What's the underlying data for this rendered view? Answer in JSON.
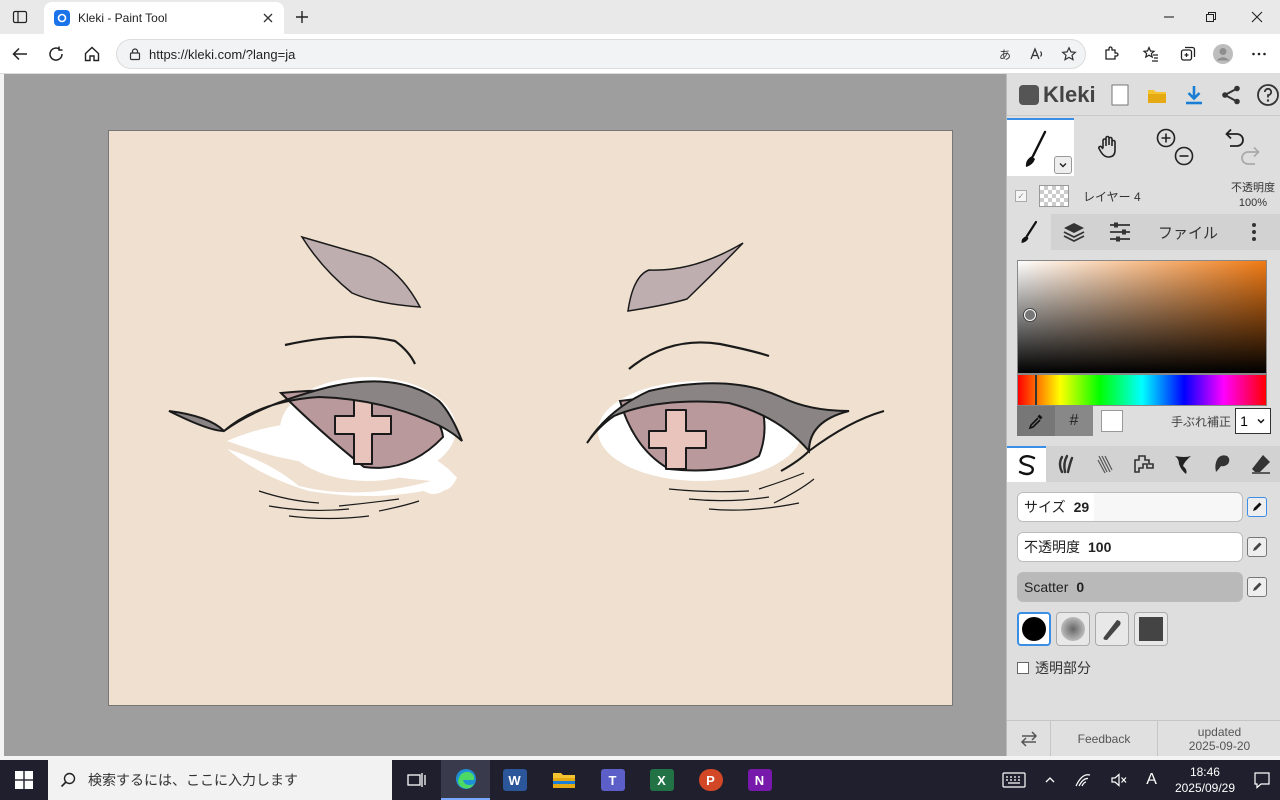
{
  "browser": {
    "tab_title": "Kleki - Paint Tool",
    "url": "https://kleki.com/?lang=ja",
    "translate_label": "あ"
  },
  "app": {
    "logo_text": "Kleki",
    "layer": {
      "name": "レイヤー 4",
      "opacity_label": "不透明度",
      "opacity_value": "100%"
    },
    "tabs": {
      "file_label": "ファイル"
    },
    "color": {
      "hex_label": "#",
      "selected_color": "#ffffff",
      "stabilizer_label": "手ぶれ補正",
      "stabilizer_value": "1"
    },
    "sliders": {
      "size": {
        "label": "サイズ",
        "value": "29",
        "fraction": 0.34
      },
      "opacity": {
        "label": "不透明度",
        "value": "100",
        "fraction": 1.0
      },
      "scatter": {
        "label": "Scatter",
        "value": "0",
        "fraction": 0.0
      }
    },
    "alpha_lock_label": "透明部分",
    "footer": {
      "feedback": "Feedback",
      "updated_label": "updated",
      "updated_date": "2025-09-20"
    }
  },
  "taskbar": {
    "search_placeholder": "検索するには、ここに入力します",
    "ime_label": "A",
    "time": "18:46",
    "date": "2025/09/29"
  },
  "colors": {
    "canvas_bg": "#efe0cf",
    "accent": "#3a8ee6",
    "iris": "#b9999b",
    "cross": "#e8c4bc",
    "lid": "#8a8584",
    "brow": "#bfaeaf"
  }
}
